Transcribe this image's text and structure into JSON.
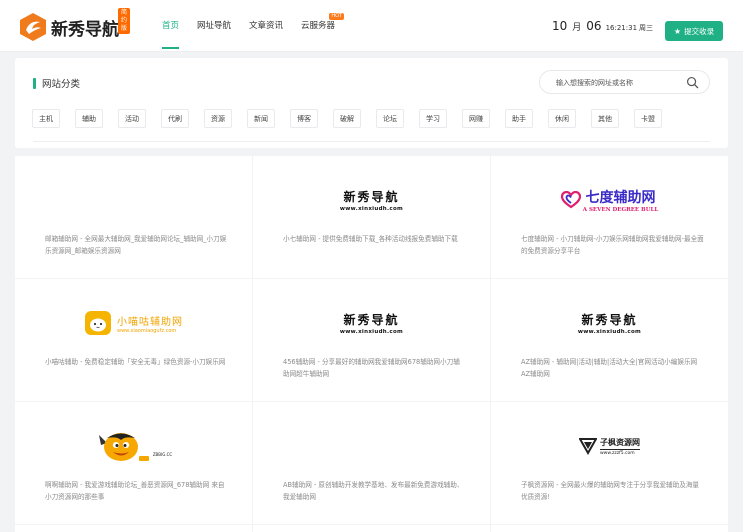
{
  "header": {
    "logo_text": "新秀导航",
    "logo_badge": "简约版",
    "nav": [
      {
        "label": "首页",
        "active": true
      },
      {
        "label": "网址导航"
      },
      {
        "label": "文章资讯"
      },
      {
        "label": "云服务器",
        "badge": "HOT"
      }
    ],
    "date": {
      "month": "10",
      "month_unit": "月",
      "day": "06",
      "time": "16:21:31",
      "weekday": "周三"
    },
    "submit_label": "提交收录"
  },
  "category": {
    "title": "网站分类",
    "search_placeholder": "输入想搜索的网址或名称",
    "tags": [
      "主机",
      "辅助",
      "活动",
      "代刷",
      "资源",
      "新闻",
      "博客",
      "破解",
      "论坛",
      "学习",
      "网赚",
      "助手",
      "休闲",
      "其他",
      "卡盟"
    ]
  },
  "sites": [
    {
      "logo": "none",
      "desc": "邮箱辅助网 - 全网最大辅助网_我爱辅助网论坛_辅助网_小刀娱乐资源网_邮箱娱乐资源网"
    },
    {
      "logo": "xinxiu",
      "logo_title": "新秀导航",
      "logo_url": "www.xinxiudh.com",
      "desc": "小七辅助网 - 提供免费辅助下载_各种活动线报免费辅助下载"
    },
    {
      "logo": "qidu",
      "logo_title": "七度辅助网",
      "logo_sub": "A SEVEN DEGREE BULL",
      "desc": "七度辅助网 - 小刀辅助网-小刀娱乐网辅助网我爱辅助网-最全面的免费资源分享平台"
    },
    {
      "logo": "xiaolu",
      "logo_title": "小喵咕辅助网",
      "logo_url": "www.xiaomiaogufz.com",
      "desc": "小喵咕辅助 - 免费稳定辅助「安全无毒」绿色资源-小刀娱乐网"
    },
    {
      "logo": "xinxiu",
      "logo_title": "新秀导航",
      "logo_url": "www.xinxiudh.com",
      "desc": "456辅助网 - 分享最好的辅助网我爱辅助网678辅助网小刀辅助网超牛辅助网"
    },
    {
      "logo": "xinxiu",
      "logo_title": "新秀导航",
      "logo_url": "www.xinxiudh.com",
      "desc": "AZ辅助网 - 辅助网|活动|辅助|活动大全|官网活动小编娱乐网AZ辅助网"
    },
    {
      "logo": "zbbig",
      "logo_url": "ZBBIG.CC",
      "desc": "啊啊辅助网 - 我爱游戏辅助论坛_善恶资源网_678辅助网 来自小刀资源网的那些事"
    },
    {
      "logo": "none",
      "desc": "AB辅助网 - 原创辅助开发教学基地、发布最新免费游戏辅助、我爱辅助网"
    },
    {
      "logo": "zifeng",
      "logo_title": "子枫资源网",
      "logo_url": "www.zzzf5.com",
      "desc": "子枫资源网 - 全网最火爆的辅助网专注于分享我爱辅助及海量优质资源!"
    },
    {
      "logo": "none",
      "desc": ""
    },
    {
      "logo": "none",
      "desc": ""
    },
    {
      "logo": "none",
      "desc": ""
    }
  ],
  "colors": {
    "accent": "#1fb185",
    "hot": "#ff7a1a",
    "logo_orange": "#f07b1c"
  }
}
